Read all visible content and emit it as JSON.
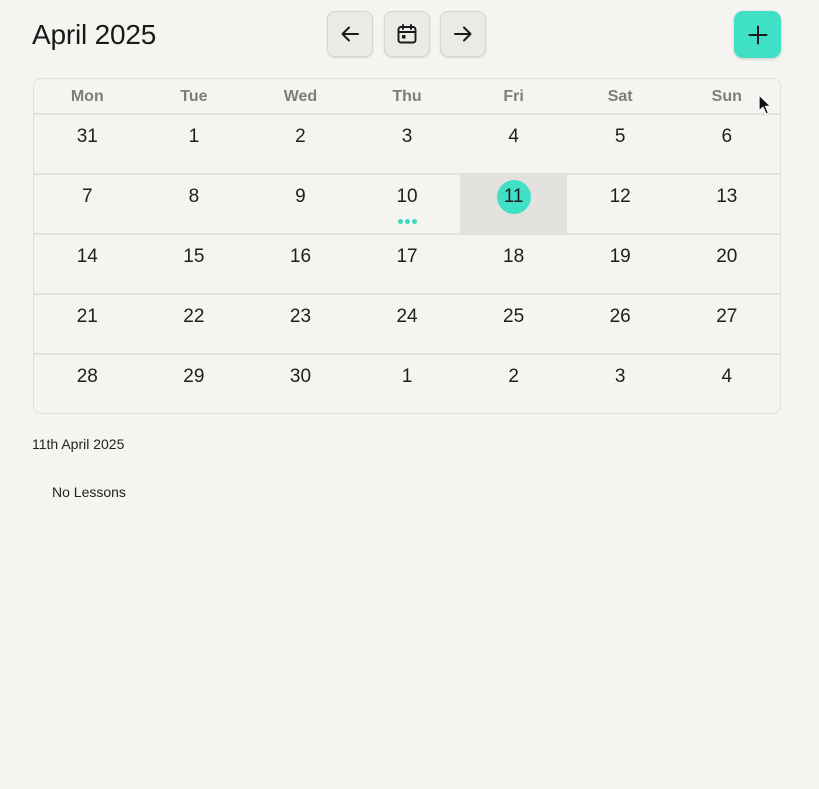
{
  "header": {
    "title": "April 2025",
    "prev_icon": "arrow-left-icon",
    "today_icon": "calendar-icon",
    "next_icon": "arrow-right-icon",
    "add_icon": "plus-icon"
  },
  "colors": {
    "accent": "#3fe0c6",
    "background": "#f5f4f0",
    "selected_cell": "#e3e2de"
  },
  "calendar": {
    "weekdays": [
      "Mon",
      "Tue",
      "Wed",
      "Thu",
      "Fri",
      "Sat",
      "Sun"
    ],
    "weeks": [
      [
        "31",
        "1",
        "2",
        "3",
        "4",
        "5",
        "6"
      ],
      [
        "7",
        "8",
        "9",
        "10",
        "11",
        "12",
        "13"
      ],
      [
        "14",
        "15",
        "16",
        "17",
        "18",
        "19",
        "20"
      ],
      [
        "21",
        "22",
        "23",
        "24",
        "25",
        "26",
        "27"
      ],
      [
        "28",
        "29",
        "30",
        "1",
        "2",
        "3",
        "4"
      ]
    ],
    "selected_day": "11",
    "days_with_events": [
      "10"
    ]
  },
  "selection": {
    "date_label": "11th April 2025",
    "empty_message": "No Lessons"
  }
}
